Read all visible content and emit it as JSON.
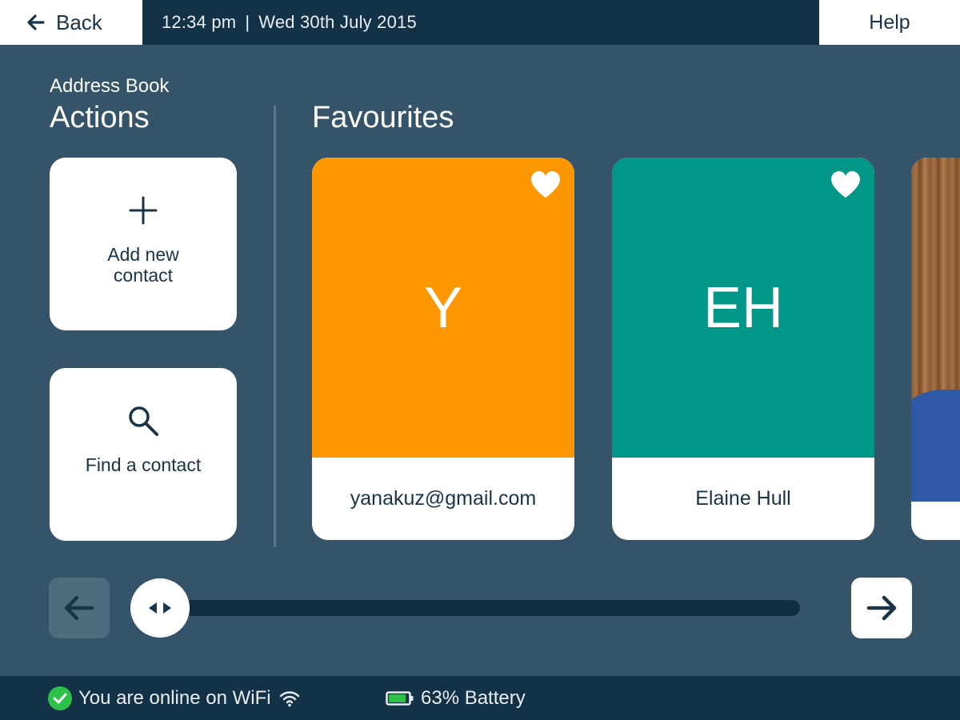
{
  "header": {
    "back_label": "Back",
    "time": "12:34 pm",
    "separator": "|",
    "date": "Wed 30th July 2015",
    "help_label": "Help"
  },
  "page": {
    "kicker": "Address Book",
    "actions_title": "Actions",
    "favourites_title": "Favourites"
  },
  "actions": [
    {
      "label": "Add new contact",
      "icon": "plus-icon"
    },
    {
      "label": "Find a contact",
      "icon": "search-icon"
    }
  ],
  "favourites": [
    {
      "initials": "Y",
      "name": "yanakuz@gmail.com",
      "color": "#ff9800",
      "favourite": true
    },
    {
      "initials": "EH",
      "name": "Elaine Hull",
      "color": "#009688",
      "favourite": true
    },
    {
      "initials": "",
      "name": "",
      "photo": true
    }
  ],
  "carousel": {
    "position": 0
  },
  "status": {
    "connection": "You are online on WiFi",
    "battery": "63% Battery",
    "battery_level": 0.63,
    "online_color": "#2ec14a"
  },
  "colors": {
    "background": "#35546a",
    "bar": "#143247",
    "text_dark": "#1b3346"
  }
}
